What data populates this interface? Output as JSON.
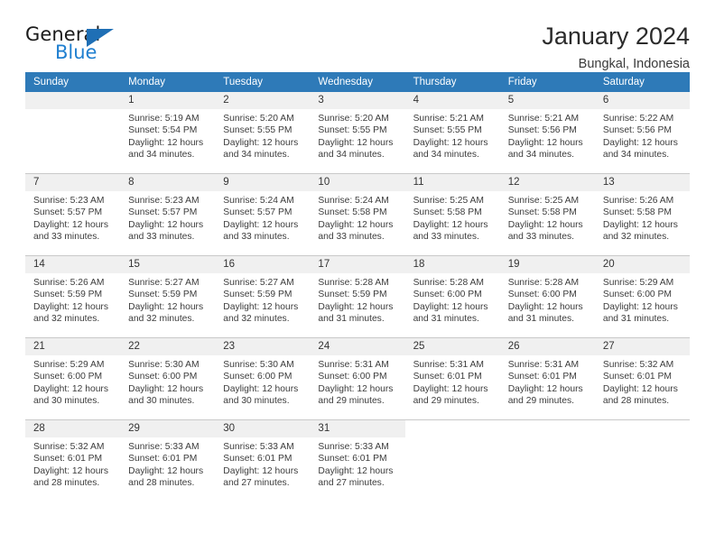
{
  "brand": {
    "name_dark": "General",
    "name_blue": "Blue",
    "accent_blue": "#1f7fd0",
    "triangle_blue": "#1f6fb5"
  },
  "header": {
    "title": "January 2024",
    "location": "Bungkal, Indonesia"
  },
  "calendar": {
    "header_bg": "#2e7ab8",
    "daynum_bg": "#f0f0f0",
    "weekdays": [
      "Sunday",
      "Monday",
      "Tuesday",
      "Wednesday",
      "Thursday",
      "Friday",
      "Saturday"
    ],
    "weeks": [
      [
        {
          "day": "",
          "sunrise": "",
          "sunset": "",
          "daylight1": "",
          "daylight2": "",
          "empty": true
        },
        {
          "day": "1",
          "sunrise": "Sunrise: 5:19 AM",
          "sunset": "Sunset: 5:54 PM",
          "daylight1": "Daylight: 12 hours",
          "daylight2": "and 34 minutes."
        },
        {
          "day": "2",
          "sunrise": "Sunrise: 5:20 AM",
          "sunset": "Sunset: 5:55 PM",
          "daylight1": "Daylight: 12 hours",
          "daylight2": "and 34 minutes."
        },
        {
          "day": "3",
          "sunrise": "Sunrise: 5:20 AM",
          "sunset": "Sunset: 5:55 PM",
          "daylight1": "Daylight: 12 hours",
          "daylight2": "and 34 minutes."
        },
        {
          "day": "4",
          "sunrise": "Sunrise: 5:21 AM",
          "sunset": "Sunset: 5:55 PM",
          "daylight1": "Daylight: 12 hours",
          "daylight2": "and 34 minutes."
        },
        {
          "day": "5",
          "sunrise": "Sunrise: 5:21 AM",
          "sunset": "Sunset: 5:56 PM",
          "daylight1": "Daylight: 12 hours",
          "daylight2": "and 34 minutes."
        },
        {
          "day": "6",
          "sunrise": "Sunrise: 5:22 AM",
          "sunset": "Sunset: 5:56 PM",
          "daylight1": "Daylight: 12 hours",
          "daylight2": "and 34 minutes."
        }
      ],
      [
        {
          "day": "7",
          "sunrise": "Sunrise: 5:23 AM",
          "sunset": "Sunset: 5:57 PM",
          "daylight1": "Daylight: 12 hours",
          "daylight2": "and 33 minutes."
        },
        {
          "day": "8",
          "sunrise": "Sunrise: 5:23 AM",
          "sunset": "Sunset: 5:57 PM",
          "daylight1": "Daylight: 12 hours",
          "daylight2": "and 33 minutes."
        },
        {
          "day": "9",
          "sunrise": "Sunrise: 5:24 AM",
          "sunset": "Sunset: 5:57 PM",
          "daylight1": "Daylight: 12 hours",
          "daylight2": "and 33 minutes."
        },
        {
          "day": "10",
          "sunrise": "Sunrise: 5:24 AM",
          "sunset": "Sunset: 5:58 PM",
          "daylight1": "Daylight: 12 hours",
          "daylight2": "and 33 minutes."
        },
        {
          "day": "11",
          "sunrise": "Sunrise: 5:25 AM",
          "sunset": "Sunset: 5:58 PM",
          "daylight1": "Daylight: 12 hours",
          "daylight2": "and 33 minutes."
        },
        {
          "day": "12",
          "sunrise": "Sunrise: 5:25 AM",
          "sunset": "Sunset: 5:58 PM",
          "daylight1": "Daylight: 12 hours",
          "daylight2": "and 33 minutes."
        },
        {
          "day": "13",
          "sunrise": "Sunrise: 5:26 AM",
          "sunset": "Sunset: 5:58 PM",
          "daylight1": "Daylight: 12 hours",
          "daylight2": "and 32 minutes."
        }
      ],
      [
        {
          "day": "14",
          "sunrise": "Sunrise: 5:26 AM",
          "sunset": "Sunset: 5:59 PM",
          "daylight1": "Daylight: 12 hours",
          "daylight2": "and 32 minutes."
        },
        {
          "day": "15",
          "sunrise": "Sunrise: 5:27 AM",
          "sunset": "Sunset: 5:59 PM",
          "daylight1": "Daylight: 12 hours",
          "daylight2": "and 32 minutes."
        },
        {
          "day": "16",
          "sunrise": "Sunrise: 5:27 AM",
          "sunset": "Sunset: 5:59 PM",
          "daylight1": "Daylight: 12 hours",
          "daylight2": "and 32 minutes."
        },
        {
          "day": "17",
          "sunrise": "Sunrise: 5:28 AM",
          "sunset": "Sunset: 5:59 PM",
          "daylight1": "Daylight: 12 hours",
          "daylight2": "and 31 minutes."
        },
        {
          "day": "18",
          "sunrise": "Sunrise: 5:28 AM",
          "sunset": "Sunset: 6:00 PM",
          "daylight1": "Daylight: 12 hours",
          "daylight2": "and 31 minutes."
        },
        {
          "day": "19",
          "sunrise": "Sunrise: 5:28 AM",
          "sunset": "Sunset: 6:00 PM",
          "daylight1": "Daylight: 12 hours",
          "daylight2": "and 31 minutes."
        },
        {
          "day": "20",
          "sunrise": "Sunrise: 5:29 AM",
          "sunset": "Sunset: 6:00 PM",
          "daylight1": "Daylight: 12 hours",
          "daylight2": "and 31 minutes."
        }
      ],
      [
        {
          "day": "21",
          "sunrise": "Sunrise: 5:29 AM",
          "sunset": "Sunset: 6:00 PM",
          "daylight1": "Daylight: 12 hours",
          "daylight2": "and 30 minutes."
        },
        {
          "day": "22",
          "sunrise": "Sunrise: 5:30 AM",
          "sunset": "Sunset: 6:00 PM",
          "daylight1": "Daylight: 12 hours",
          "daylight2": "and 30 minutes."
        },
        {
          "day": "23",
          "sunrise": "Sunrise: 5:30 AM",
          "sunset": "Sunset: 6:00 PM",
          "daylight1": "Daylight: 12 hours",
          "daylight2": "and 30 minutes."
        },
        {
          "day": "24",
          "sunrise": "Sunrise: 5:31 AM",
          "sunset": "Sunset: 6:00 PM",
          "daylight1": "Daylight: 12 hours",
          "daylight2": "and 29 minutes."
        },
        {
          "day": "25",
          "sunrise": "Sunrise: 5:31 AM",
          "sunset": "Sunset: 6:01 PM",
          "daylight1": "Daylight: 12 hours",
          "daylight2": "and 29 minutes."
        },
        {
          "day": "26",
          "sunrise": "Sunrise: 5:31 AM",
          "sunset": "Sunset: 6:01 PM",
          "daylight1": "Daylight: 12 hours",
          "daylight2": "and 29 minutes."
        },
        {
          "day": "27",
          "sunrise": "Sunrise: 5:32 AM",
          "sunset": "Sunset: 6:01 PM",
          "daylight1": "Daylight: 12 hours",
          "daylight2": "and 28 minutes."
        }
      ],
      [
        {
          "day": "28",
          "sunrise": "Sunrise: 5:32 AM",
          "sunset": "Sunset: 6:01 PM",
          "daylight1": "Daylight: 12 hours",
          "daylight2": "and 28 minutes."
        },
        {
          "day": "29",
          "sunrise": "Sunrise: 5:33 AM",
          "sunset": "Sunset: 6:01 PM",
          "daylight1": "Daylight: 12 hours",
          "daylight2": "and 28 minutes."
        },
        {
          "day": "30",
          "sunrise": "Sunrise: 5:33 AM",
          "sunset": "Sunset: 6:01 PM",
          "daylight1": "Daylight: 12 hours",
          "daylight2": "and 27 minutes."
        },
        {
          "day": "31",
          "sunrise": "Sunrise: 5:33 AM",
          "sunset": "Sunset: 6:01 PM",
          "daylight1": "Daylight: 12 hours",
          "daylight2": "and 27 minutes."
        },
        {
          "day": "",
          "sunrise": "",
          "sunset": "",
          "daylight1": "",
          "daylight2": "",
          "blank": true
        },
        {
          "day": "",
          "sunrise": "",
          "sunset": "",
          "daylight1": "",
          "daylight2": "",
          "blank": true
        },
        {
          "day": "",
          "sunrise": "",
          "sunset": "",
          "daylight1": "",
          "daylight2": "",
          "blank": true
        }
      ]
    ]
  }
}
